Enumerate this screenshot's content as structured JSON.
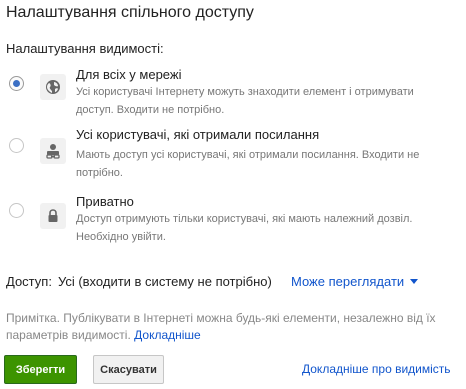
{
  "dialog": {
    "title": "Налаштування спільного доступу",
    "visibility_label": "Налаштування видимості:"
  },
  "options": [
    {
      "title": "Для всіх у мережі",
      "description": "Усі користувачі Інтернету можуть знаходити елемент і отримувати доступ. Входити не потрібно.",
      "icon": "globe-icon",
      "selected": true
    },
    {
      "title": "Усі користувачі, які отримали посилання",
      "description": "Мають доступ усі користувачі, які отримали посилання. Входити не потрібно.",
      "icon": "person-link-icon",
      "selected": false
    },
    {
      "title": "Приватно",
      "description": "Доступ отримують тільки користувачі, які мають належний дозвіл. Необхідно увійти.",
      "icon": "lock-icon",
      "selected": false
    }
  ],
  "access": {
    "label": "Доступ:",
    "value": "Усі (входити в систему не потрібно)",
    "permission": "Може переглядати"
  },
  "note": {
    "text": "Примітка. Публікувати в Інтернеті можна будь-які елементи, незалежно від їх параметрів видимості.",
    "link": "Докладніше"
  },
  "buttons": {
    "save": "Зберегти",
    "cancel": "Скасувати",
    "learn_more": "Докладніше про видимість"
  },
  "colors": {
    "link": "#1155cc",
    "save_button": "#3d9400",
    "radio_selected": "#3b6fc4"
  }
}
